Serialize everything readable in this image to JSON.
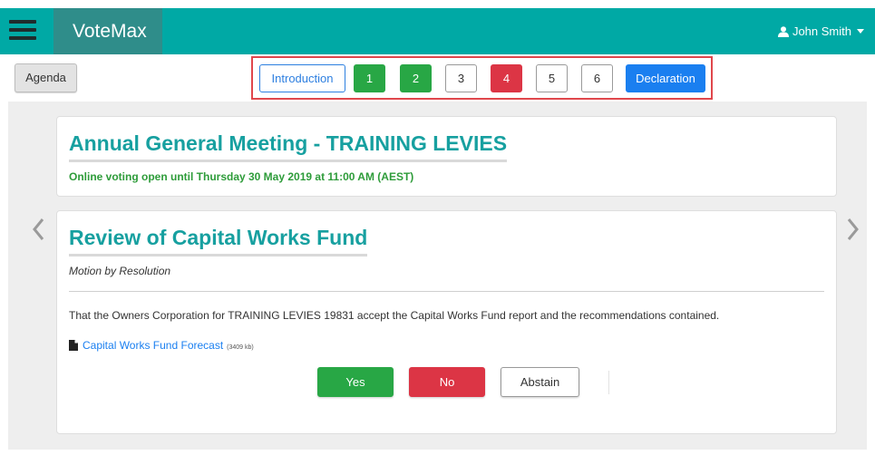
{
  "header": {
    "brand": "VoteMax",
    "user_name": "John Smith"
  },
  "nav": {
    "agenda_label": "Agenda",
    "steps": [
      {
        "label": "Introduction",
        "state": "outline-primary"
      },
      {
        "label": "1",
        "state": "success"
      },
      {
        "label": "2",
        "state": "success"
      },
      {
        "label": "3",
        "state": "default"
      },
      {
        "label": "4",
        "state": "danger"
      },
      {
        "label": "5",
        "state": "default"
      },
      {
        "label": "6",
        "state": "default"
      },
      {
        "label": "Declaration",
        "state": "primary"
      }
    ]
  },
  "meeting": {
    "title": "Annual General Meeting - TRAINING LEVIES",
    "voting_open": "Online voting open until Thursday 30 May 2019 at 11:00 AM (AEST)"
  },
  "motion": {
    "title": "Review of Capital Works Fund",
    "type": "Motion by Resolution",
    "resolution": "That the Owners Corporation for TRAINING LEVIES 19831 accept the Capital Works Fund report and the recommendations contained.",
    "document": {
      "name": "Capital Works Fund Forecast",
      "size": "(3409 kb)",
      "icon": "file-icon"
    }
  },
  "vote": {
    "yes_label": "Yes",
    "no_label": "No",
    "abstain_label": "Abstain"
  },
  "colors": {
    "topbar": "#00a9a5",
    "brand_bg": "#2f8d8a",
    "title_teal": "#17a0a0",
    "success": "#28a745",
    "danger": "#dc3545",
    "primary": "#1a7ff0"
  }
}
